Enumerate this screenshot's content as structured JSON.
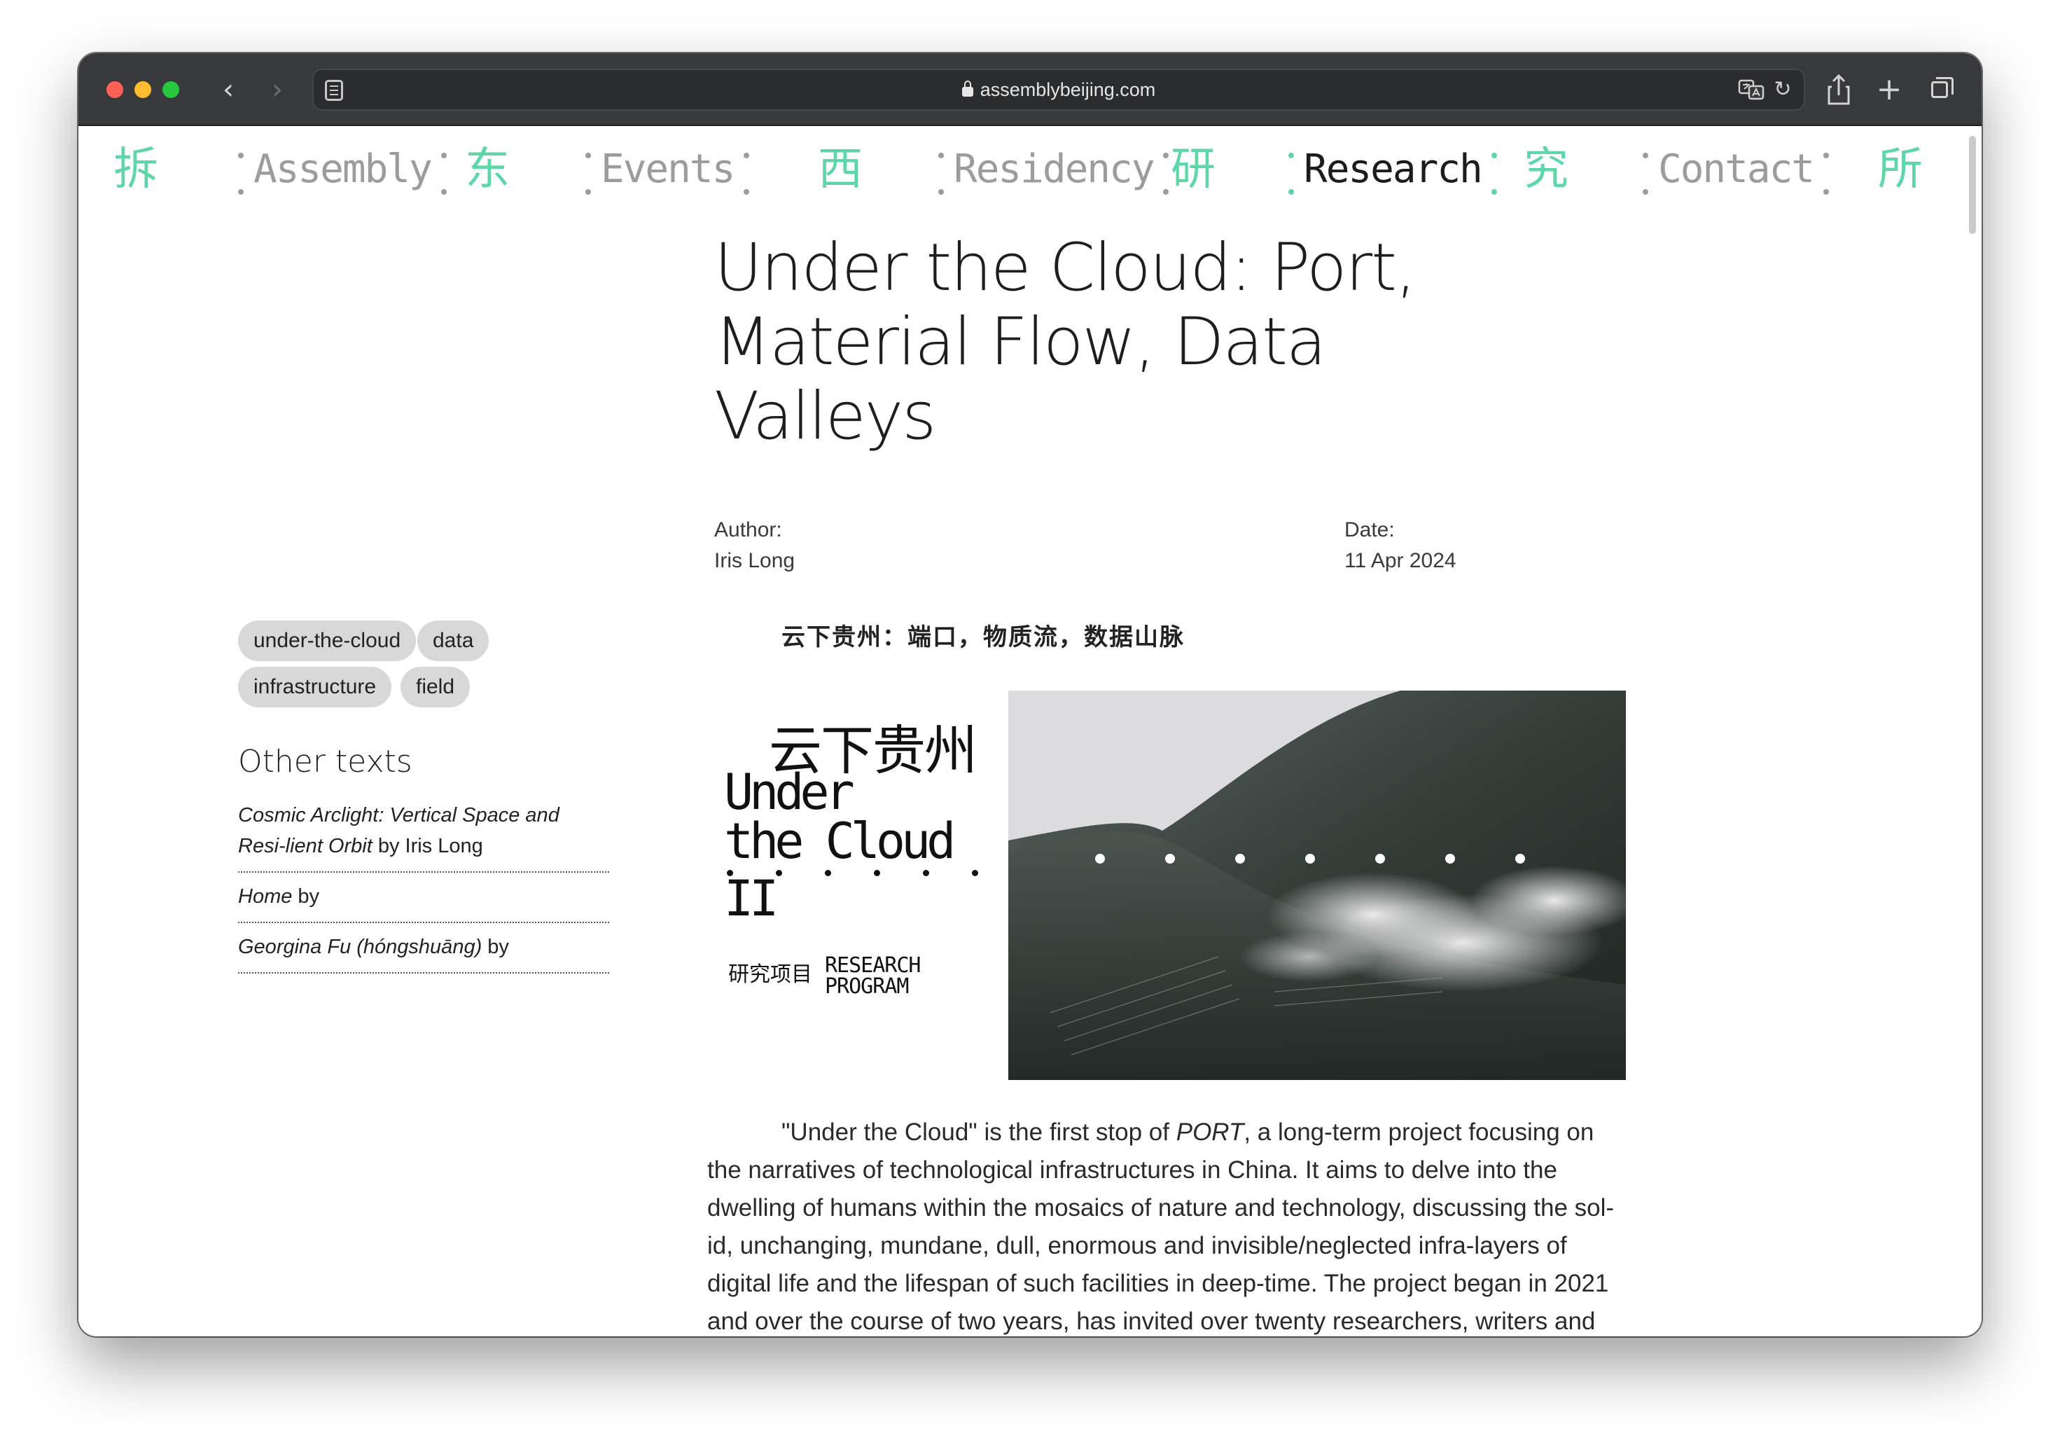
{
  "browser": {
    "url": "assemblybeijing.com"
  },
  "nav": {
    "items": [
      {
        "type": "cn",
        "label": "拆"
      },
      {
        "type": "en",
        "label": "Assembly"
      },
      {
        "type": "cn",
        "label": "东"
      },
      {
        "type": "en",
        "label": "Events"
      },
      {
        "type": "cn",
        "label": "西"
      },
      {
        "type": "en",
        "label": "Residency"
      },
      {
        "type": "cn",
        "label": "研"
      },
      {
        "type": "en",
        "label": "Research",
        "active": true
      },
      {
        "type": "cn",
        "label": "究"
      },
      {
        "type": "en",
        "label": "Contact"
      },
      {
        "type": "cn",
        "label": "所"
      }
    ]
  },
  "article": {
    "title": "Under the Cloud: Port, Material Flow, Data Valleys",
    "author_label": "Author:",
    "author": "Iris Long",
    "date_label": "Date:",
    "date": "11 Apr 2024",
    "cn_subtitle": "云下贵州：端口，物质流，数据山脉",
    "body_parts": {
      "p1": "\"Under the Cloud\" is the first stop of ",
      "port": "PORT",
      "p2": ", a long-term project focusing on the narratives of technological infrastructures in China. It aims to delve into the dwelling of humans within the mosaics of nature and technology, discussing the sol-id, unchanging, mundane, dull, enormous and invisible/neglected infra-layers of digital life and the lifespan of such facilities in deep-time. The project began in 2021 and over the course of two years, has invited over twenty researchers, writers and creat-ives from the fields of humanities, social sciences and arts. We explored infrastruc-"
    }
  },
  "logo": {
    "cn": "云下贵州",
    "en_line1": "Under",
    "en_line2": "the Cloud II",
    "sub_cn": "研究项目",
    "sub_en_line1": "RESEARCH",
    "sub_en_line2": "PROGRAM"
  },
  "tags": [
    "under-the-cloud",
    "data",
    "infrastructure",
    "field"
  ],
  "other_texts": {
    "title": "Other texts",
    "items": [
      {
        "italic": "Cosmic Arclight: Vertical Space and Resi-lient Orbit",
        "rest": " by Iris Long"
      },
      {
        "italic": "Home",
        "rest": " by"
      },
      {
        "italic": "Georgina Fu (hóngshuāng)",
        "rest": " by"
      }
    ]
  }
}
